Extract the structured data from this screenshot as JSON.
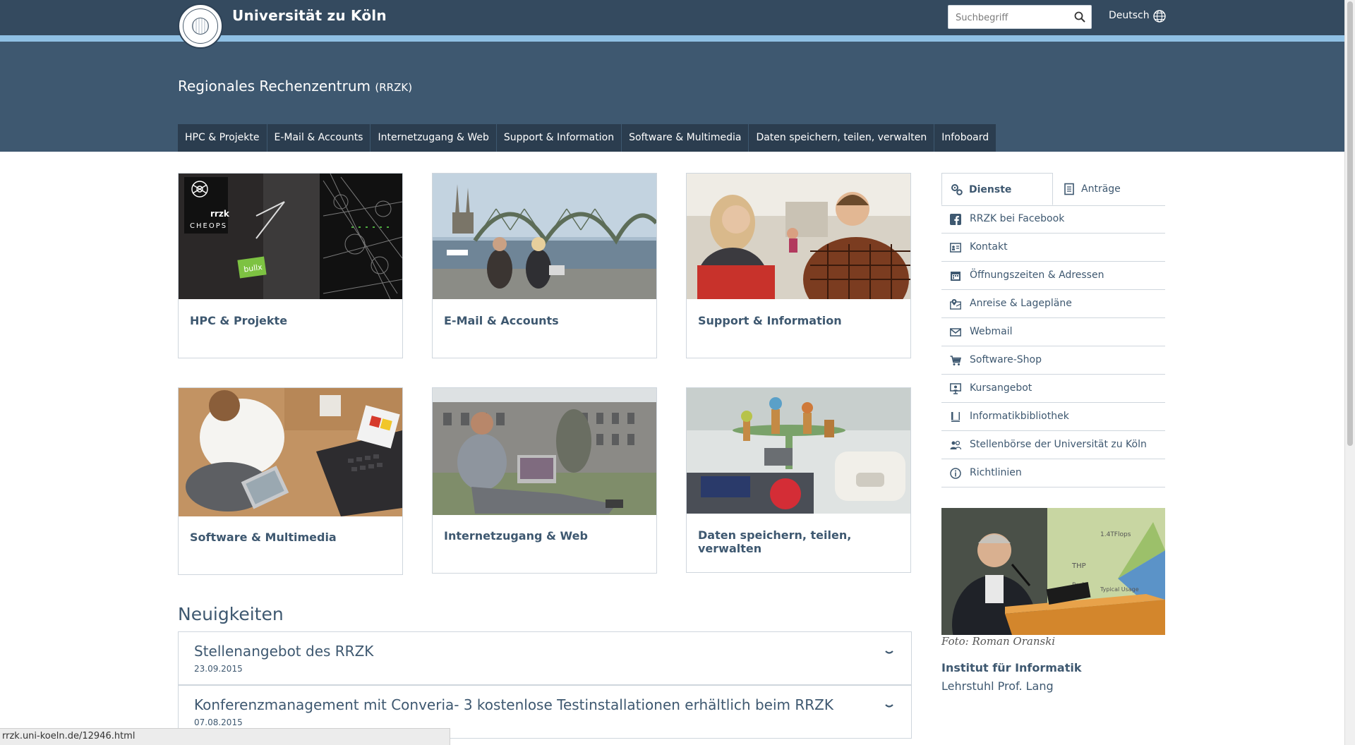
{
  "header": {
    "university": "Universität zu Köln",
    "search_placeholder": "Suchbegriff",
    "language": "Deutsch",
    "site_title": "Regionales Rechenzentrum",
    "site_abbr": "(RRZK)"
  },
  "nav": [
    "HPC & Projekte",
    "E-Mail & Accounts",
    "Internetzugang & Web",
    "Support & Information",
    "Software & Multimedia",
    "Daten speichern, teilen, verwalten",
    "Infoboard"
  ],
  "tiles": [
    {
      "label": "HPC & Projekte",
      "photo_text": [
        "rrzk",
        "CHEOPS",
        "bullx"
      ]
    },
    {
      "label": "E-Mail & Accounts"
    },
    {
      "label": "Support & Information"
    },
    {
      "label": "Software & Multimedia"
    },
    {
      "label": "Internetzugang & Web"
    },
    {
      "label": "Daten speichern, teilen, verwalten"
    }
  ],
  "news": {
    "heading": "Neuigkeiten",
    "items": [
      {
        "title": "Stellenangebot des RRZK",
        "date": "23.09.2015"
      },
      {
        "title": "Konferenzmanagement mit Converia- 3 kostenlose Testinstallationen erhältlich beim RRZK",
        "date": "07.08.2015"
      }
    ]
  },
  "sidebar": {
    "tabs": [
      {
        "label": "Dienste",
        "icon": "gears-icon",
        "active": true
      },
      {
        "label": "Anträge",
        "icon": "document-icon",
        "active": false
      }
    ],
    "services": [
      {
        "label": "RRZK bei Facebook",
        "icon": "facebook-icon"
      },
      {
        "label": "Kontakt",
        "icon": "contact-card-icon"
      },
      {
        "label": "Öffnungszeiten & Adressen",
        "icon": "calendar-icon"
      },
      {
        "label": "Anreise & Lagepläne",
        "icon": "map-pin-icon"
      },
      {
        "label": "Webmail",
        "icon": "envelope-icon"
      },
      {
        "label": "Software-Shop",
        "icon": "cart-icon"
      },
      {
        "label": "Kursangebot",
        "icon": "presentation-icon"
      },
      {
        "label": "Informatikbibliothek",
        "icon": "book-icon"
      },
      {
        "label": "Stellenbörse der Universität zu Köln",
        "icon": "people-icon"
      },
      {
        "label": "Richtlinien",
        "icon": "info-icon"
      }
    ],
    "photo_caption": "Foto: Roman Oranski",
    "photo_text": [
      "1.4TFlops",
      "THP",
      "Typical Usage",
      "Prakt"
    ],
    "institute": "Institut für Informatik",
    "chair": "Lehrstuhl Prof. Lang"
  },
  "status_url": "rrzk.uni-koeln.de/12946.html",
  "colors": {
    "topbar": "#344a5f",
    "header": "#3e5870",
    "stripe": "#8fc0e4",
    "nav_item": "#2b3d4f"
  }
}
